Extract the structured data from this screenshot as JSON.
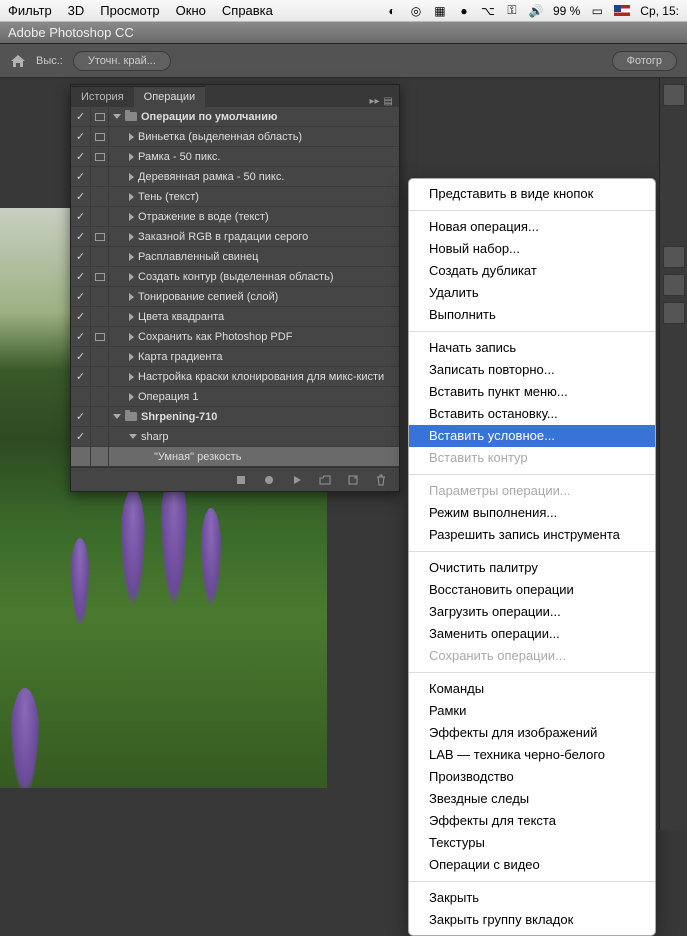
{
  "menubar": {
    "items": [
      "Фильтр",
      "3D",
      "Просмотр",
      "Окно",
      "Справка"
    ],
    "battery": "99 %",
    "clock": "Ср, 15:"
  },
  "app": {
    "title": "Adobe Photoshop CC"
  },
  "options": {
    "label_vys": "Выс.:",
    "refine_edge": "Уточн. край...",
    "right_btn": "Фотогр"
  },
  "palette": {
    "tabs": {
      "history": "История",
      "actions": "Операции"
    },
    "actions": [
      {
        "label": "Операции по умолчанию",
        "type": "set",
        "open": true,
        "checked": true,
        "dialog": true,
        "indent": 0
      },
      {
        "label": "Виньетка (выделенная область)",
        "type": "action",
        "checked": true,
        "dialog": true,
        "indent": 1
      },
      {
        "label": "Рамка - 50 пикс.",
        "type": "action",
        "checked": true,
        "dialog": true,
        "indent": 1
      },
      {
        "label": "Деревянная рамка - 50 пикс.",
        "type": "action",
        "checked": true,
        "dialog": false,
        "indent": 1
      },
      {
        "label": "Тень (текст)",
        "type": "action",
        "checked": true,
        "dialog": false,
        "indent": 1
      },
      {
        "label": "Отражение в воде (текст)",
        "type": "action",
        "checked": true,
        "dialog": false,
        "indent": 1
      },
      {
        "label": "Заказной RGB в градации серого",
        "type": "action",
        "checked": true,
        "dialog": true,
        "indent": 1
      },
      {
        "label": "Расплавленный свинец",
        "type": "action",
        "checked": true,
        "dialog": false,
        "indent": 1
      },
      {
        "label": "Создать контур (выделенная область)",
        "type": "action",
        "checked": true,
        "dialog": true,
        "indent": 1
      },
      {
        "label": "Тонирование сепией (слой)",
        "type": "action",
        "checked": true,
        "dialog": false,
        "indent": 1
      },
      {
        "label": "Цвета квадранта",
        "type": "action",
        "checked": true,
        "dialog": false,
        "indent": 1
      },
      {
        "label": "Сохранить как Photoshop PDF",
        "type": "action",
        "checked": true,
        "dialog": true,
        "indent": 1
      },
      {
        "label": "Карта градиента",
        "type": "action",
        "checked": true,
        "dialog": false,
        "indent": 1
      },
      {
        "label": "Настройка краски клонирования для микс-кисти",
        "type": "action",
        "checked": true,
        "dialog": false,
        "indent": 1
      },
      {
        "label": "Операция 1",
        "type": "action",
        "checked": false,
        "dialog": false,
        "indent": 1
      },
      {
        "label": "Shrpening-710",
        "type": "set",
        "open": true,
        "checked": true,
        "dialog": false,
        "indent": 0
      },
      {
        "label": "sharp",
        "type": "action",
        "open": true,
        "checked": true,
        "dialog": false,
        "indent": 1
      },
      {
        "label": "\"Умная\" резкость",
        "type": "step",
        "checked": false,
        "dialog": false,
        "indent": 2,
        "selected": true
      }
    ]
  },
  "context_menu": {
    "groups": [
      [
        {
          "label": "Представить в виде кнопок",
          "enabled": true
        }
      ],
      [
        {
          "label": "Новая операция...",
          "enabled": true
        },
        {
          "label": "Новый набор...",
          "enabled": true
        },
        {
          "label": "Создать дубликат",
          "enabled": true
        },
        {
          "label": "Удалить",
          "enabled": true
        },
        {
          "label": "Выполнить",
          "enabled": true
        }
      ],
      [
        {
          "label": "Начать запись",
          "enabled": true
        },
        {
          "label": "Записать повторно...",
          "enabled": true
        },
        {
          "label": "Вставить пункт меню...",
          "enabled": true
        },
        {
          "label": "Вставить остановку...",
          "enabled": true
        },
        {
          "label": "Вставить условное...",
          "enabled": true,
          "highlighted": true
        },
        {
          "label": "Вставить контур",
          "enabled": false
        }
      ],
      [
        {
          "label": "Параметры операции...",
          "enabled": false
        },
        {
          "label": "Режим выполнения...",
          "enabled": true
        },
        {
          "label": "Разрешить запись инструмента",
          "enabled": true
        }
      ],
      [
        {
          "label": "Очистить палитру",
          "enabled": true
        },
        {
          "label": "Восстановить операции",
          "enabled": true
        },
        {
          "label": "Загрузить операции...",
          "enabled": true
        },
        {
          "label": "Заменить операции...",
          "enabled": true
        },
        {
          "label": "Сохранить операции...",
          "enabled": false
        }
      ],
      [
        {
          "label": "Команды",
          "enabled": true
        },
        {
          "label": "Рамки",
          "enabled": true
        },
        {
          "label": "Эффекты для изображений",
          "enabled": true
        },
        {
          "label": "LAB — техника черно-белого",
          "enabled": true
        },
        {
          "label": "Производство",
          "enabled": true
        },
        {
          "label": "Звездные следы",
          "enabled": true
        },
        {
          "label": "Эффекты для текста",
          "enabled": true
        },
        {
          "label": "Текстуры",
          "enabled": true
        },
        {
          "label": "Операции с видео",
          "enabled": true
        }
      ],
      [
        {
          "label": "Закрыть",
          "enabled": true
        },
        {
          "label": "Закрыть группу вкладок",
          "enabled": true
        }
      ]
    ]
  }
}
